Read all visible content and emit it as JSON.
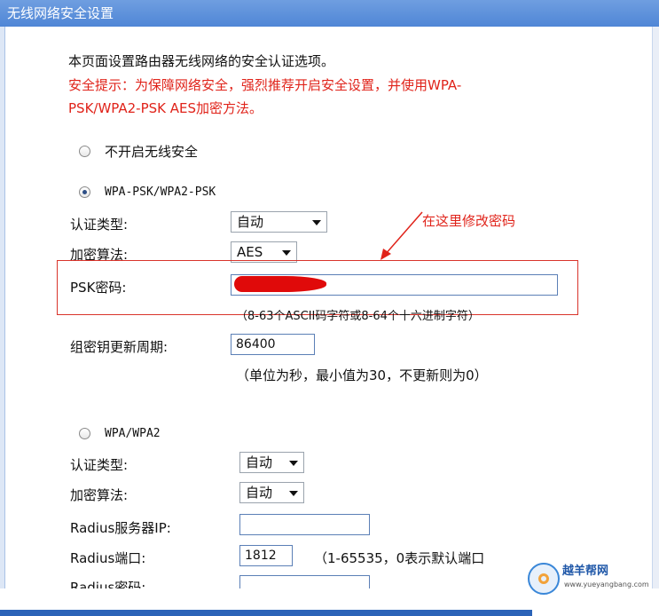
{
  "page": {
    "title": "无线网络安全设置"
  },
  "intro": {
    "description": "本页面设置路由器无线网络的安全认证选项。",
    "tip_line1": "安全提示：为保障网络安全，强烈推荐开启安全设置，并使用WPA-",
    "tip_line2": "PSK/WPA2-PSK AES加密方法。"
  },
  "security_modes": {
    "none_label": "不开启无线安全",
    "wpa_psk_label": "WPA-PSK/WPA2-PSK",
    "wpa_label": "WPA/WPA2",
    "selected": "WPA-PSK/WPA2-PSK"
  },
  "wpa_psk": {
    "auth_type_label": "认证类型:",
    "auth_type_value": "自动",
    "cipher_label": "加密算法:",
    "cipher_value": "AES",
    "psk_label": "PSK密码:",
    "psk_hint": "（8-63个ASCII码字符或8-64个十六进制字符）",
    "group_key_label": "组密钥更新周期:",
    "group_key_value": "86400",
    "group_key_hint": "（单位为秒，最小值为30，不更新则为0）",
    "annotation": "在这里修改密码"
  },
  "wpa": {
    "auth_type_label": "认证类型:",
    "auth_type_value": "自动",
    "cipher_label": "加密算法:",
    "cipher_value": "自动",
    "radius_ip_label": "Radius服务器IP:",
    "radius_ip_value": "",
    "radius_port_label": "Radius端口:",
    "radius_port_value": "1812",
    "radius_port_hint": "（1-65535，0表示默认端口",
    "radius_password_label": "Radius密码:"
  },
  "watermark": {
    "brand": "越羊帮网",
    "url": "www.yueyangbang.com"
  },
  "colors": {
    "title_bar": "#4f86d6",
    "warning_text": "#e0231a",
    "highlight_box": "#d9342b"
  }
}
